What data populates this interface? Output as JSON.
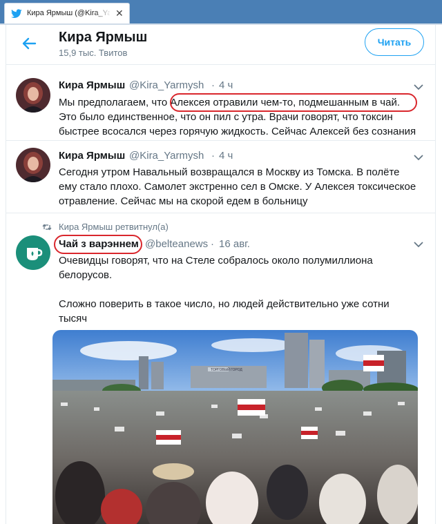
{
  "browser": {
    "tab_title": "Кира Ярмыш (@Kira_Yarmysh",
    "tab_close": "✕"
  },
  "header": {
    "name": "Кира Ярмыш",
    "tweet_count": "15,9 тыс. Твитов",
    "follow_label": "Читать"
  },
  "tweets": [
    {
      "name": "Кира Ярмыш",
      "handle": "@Kira_Yarmysh",
      "sep": "·",
      "time": "4 ч",
      "lines": [
        "Мы предполагаем, что Алексея отравили чем-то, подмешанным в чай.",
        "Это было единственное, что он пил с утра. Врачи говорят, что токсин",
        "быстрее всосался через горячую жидкость. Сейчас Алексей без сознания"
      ]
    },
    {
      "name": "Кира Ярмыш",
      "handle": "@Kira_Yarmysh",
      "sep": "·",
      "time": "4 ч",
      "lines": [
        "Сегодня утром Навальный возвращался в Москву из Томска. В полёте",
        "ему стало плохо. Самолет экстренно сел в Омске. У Алексея токсическое",
        "отравление. Сейчас мы на скорой едем в больницу"
      ]
    },
    {
      "retweet_label": "Кира Ярмыш ретвитнул(а)",
      "name": "Чай з варэннем",
      "handle": "@belteanews",
      "sep": "·",
      "time": "16 авг.",
      "lines": [
        "Очевидцы говорят, что на Стеле собралось около полумиллиона",
        "белорусов.",
        "",
        "Сложно поверить в такое число, но людей действительно уже сотни",
        "тысяч"
      ]
    }
  ],
  "photo": {
    "sign_text": "ТОРГОВЫЙ ГОРОД"
  },
  "colors": {
    "accent": "#1da1f2",
    "annotation": "#d9262c",
    "tabstrip": "#4a7fb5"
  }
}
